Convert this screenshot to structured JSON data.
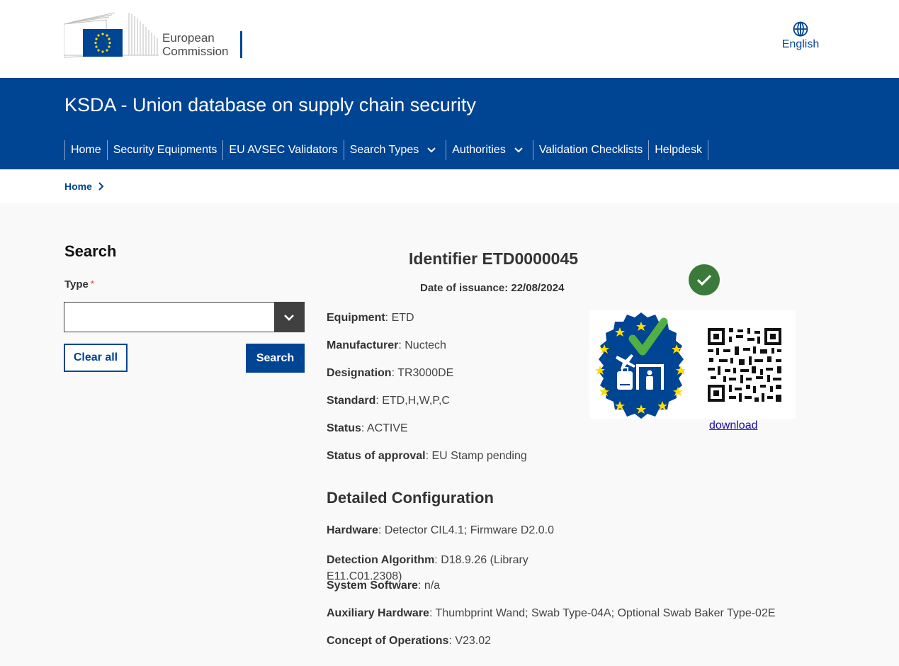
{
  "header": {
    "logo_line1": "European",
    "logo_line2": "Commission",
    "language": "English",
    "site_title": "KSDA - Union database on supply chain security"
  },
  "nav": {
    "items": [
      {
        "label": "Home",
        "dropdown": false
      },
      {
        "label": "Security Equipments",
        "dropdown": false
      },
      {
        "label": "EU AVSEC Validators",
        "dropdown": false
      },
      {
        "label": "Search Types",
        "dropdown": true
      },
      {
        "label": "Authorities",
        "dropdown": true
      },
      {
        "label": "Validation Checklists",
        "dropdown": false
      },
      {
        "label": "Helpdesk",
        "dropdown": false
      }
    ]
  },
  "breadcrumb": {
    "home": "Home"
  },
  "search": {
    "title": "Search",
    "type_label": "Type",
    "required_mark": "*",
    "type_value": "",
    "clear_label": "Clear all",
    "search_label": "Search"
  },
  "record": {
    "identifier": "Identifier ETD0000045",
    "issuance": "Date of issuance: 22/08/2024",
    "fields": [
      {
        "label": "Equipment",
        "value": ": ETD"
      },
      {
        "label": "Manufacturer",
        "value": ": Nuctech"
      },
      {
        "label": "Designation",
        "value": ": TR3000DE"
      },
      {
        "label": "Standard",
        "value": ": ETD,H,W,P,C"
      },
      {
        "label": "Status",
        "value": ": ACTIVE"
      },
      {
        "label": "Status of approval",
        "value": ": EU Stamp pending"
      }
    ],
    "download_label": "download",
    "status_color": "#3a7a3a"
  },
  "configuration": {
    "title": "Detailed Configuration",
    "hardware": {
      "label": "Hardware",
      "value": ": Detector CIL4.1; Firmware D2.0.0"
    },
    "detection_algorithm": {
      "label": "Detection Algorithm",
      "value": ": D18.9.26 (Library E11.C01.2308)"
    },
    "system_software": {
      "label": "System Software",
      "value": ": n/a"
    },
    "auxiliary_hardware": {
      "label": "Auxiliary Hardware",
      "value": ": Thumbprint Wand; Swab Type-04A; Optional Swab Baker Type-02E"
    },
    "concept_of_operations": {
      "label": "Concept of Operations",
      "value": ": V23.02"
    }
  },
  "colors": {
    "brand_blue": "#004494",
    "dark_gray": "#404040"
  }
}
